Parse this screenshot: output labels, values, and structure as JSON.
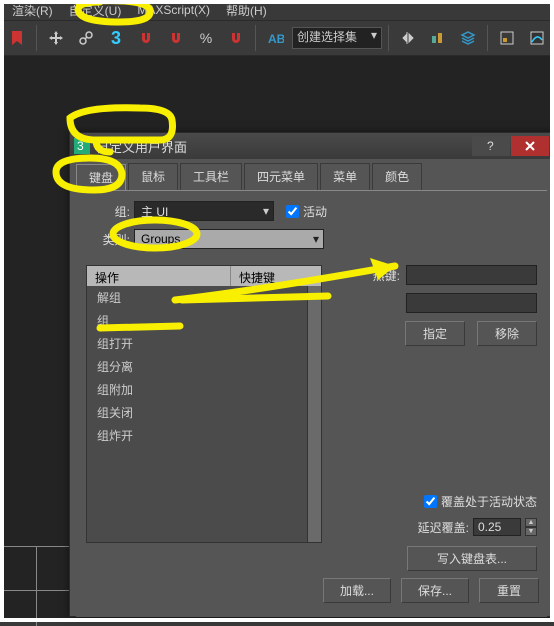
{
  "menubar": {
    "items": [
      "渲染(R)",
      "自定义(U)",
      "MAXScript(X)",
      "帮助(H)"
    ]
  },
  "toolbar": {
    "dropdown_label": "创建选择集"
  },
  "dialog": {
    "title": "自定义用户界面",
    "tabs": [
      "键盘",
      "鼠标",
      "工具栏",
      "四元菜单",
      "菜单",
      "颜色"
    ],
    "group_label": "组:",
    "group_value": "主 UI",
    "active_label": "活动",
    "category_label": "类别:",
    "category_value": "Groups",
    "list_headers": {
      "col1": "操作",
      "col2": "快捷键"
    },
    "list_items": [
      "解组",
      "组",
      "组打开",
      "组分离",
      "组附加",
      "组关闭",
      "组炸开"
    ],
    "hotkey_label": "热键:",
    "assign_btn": "指定",
    "remove_btn": "移除",
    "override_label": "覆盖处于活动状态",
    "delay_label": "延迟覆盖:",
    "delay_value": "0.25",
    "writekb_btn": "写入键盘表...",
    "load_btn": "加载...",
    "save_btn": "保存...",
    "reset_btn": "重置"
  }
}
